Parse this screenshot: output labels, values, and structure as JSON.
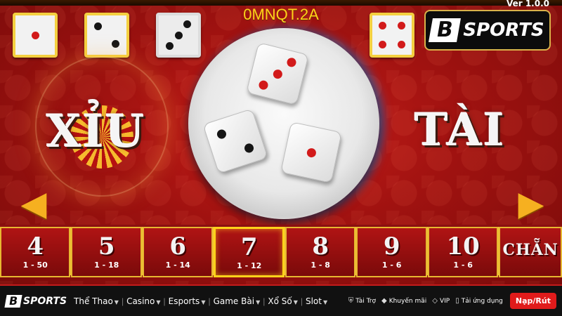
{
  "game": {
    "round_id": "0MNQT.2A",
    "version": "Ver 1.0.0",
    "label_small": "XỈU",
    "label_big": "TÀI",
    "history_dice": [
      {
        "value": 1,
        "framed": true
      },
      {
        "value": 2,
        "framed": true
      },
      {
        "value": 3,
        "framed": false
      },
      {
        "value": 4,
        "framed": true
      }
    ],
    "plate_dice": [
      {
        "value": 3
      },
      {
        "value": 2
      },
      {
        "value": 1
      }
    ],
    "bets": [
      {
        "label": "4",
        "odds": "1 - 50"
      },
      {
        "label": "5",
        "odds": "1 - 18"
      },
      {
        "label": "6",
        "odds": "1 - 14"
      },
      {
        "label": "7",
        "odds": "1 - 12",
        "active": true
      },
      {
        "label": "8",
        "odds": "1 - 8"
      },
      {
        "label": "9",
        "odds": "1 - 6"
      },
      {
        "label": "10",
        "odds": "1 - 6"
      },
      {
        "label": "CHẴN",
        "odds": ""
      }
    ],
    "colors": {
      "accent": "#ffd21a",
      "felt": "#a01210",
      "pip_red": "#d21a1a"
    }
  },
  "brand": {
    "logo_letter": "B",
    "name": "SPORTS"
  },
  "footer": {
    "nav": [
      {
        "label": "Thể Thao",
        "has_caret": true
      },
      {
        "label": "Casino",
        "has_caret": true
      },
      {
        "label": "Esports",
        "has_caret": true
      },
      {
        "label": "Game Bài",
        "has_caret": true
      },
      {
        "label": "Xổ Số",
        "has_caret": true
      },
      {
        "label": "Slot",
        "has_caret": true
      }
    ],
    "utils": [
      {
        "label": "Tài Trợ",
        "icon": "shield-icon"
      },
      {
        "label": "Khuyến mãi",
        "icon": "tag-icon"
      },
      {
        "label": "VIP",
        "icon": "diamond-icon"
      },
      {
        "label": "Tải ứng dụng",
        "icon": "phone-icon"
      }
    ],
    "cta": "Nạp/Rút"
  }
}
